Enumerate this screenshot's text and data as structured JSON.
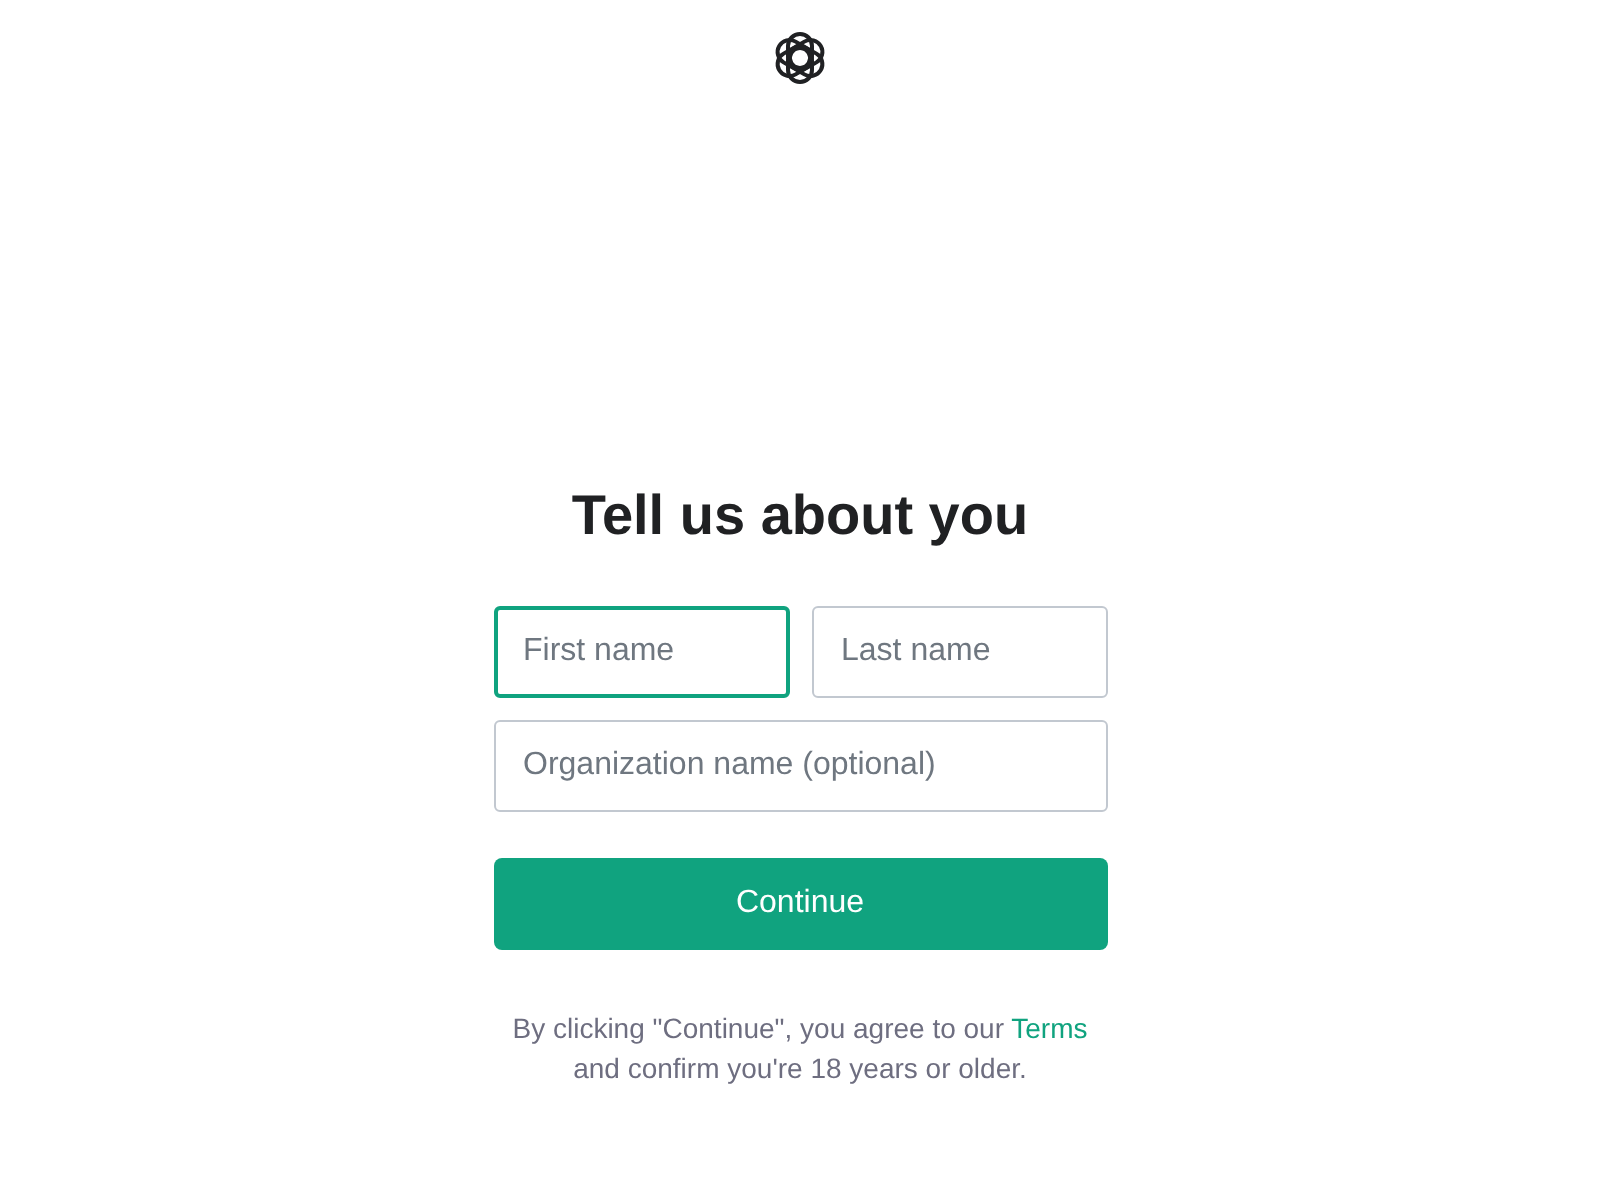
{
  "heading": "Tell us about you",
  "fields": [
    {
      "placeholder": "First name",
      "focused": true
    },
    {
      "placeholder": "Last name",
      "focused": false
    },
    {
      "placeholder": "Organization name (optional)",
      "focused": false
    }
  ],
  "continue_button": "Continue",
  "consent": {
    "text_before": "By clicking \"Continue\", you agree to our",
    "link": "Terms",
    "text_after": "and confirm you're 18 years or older."
  }
}
